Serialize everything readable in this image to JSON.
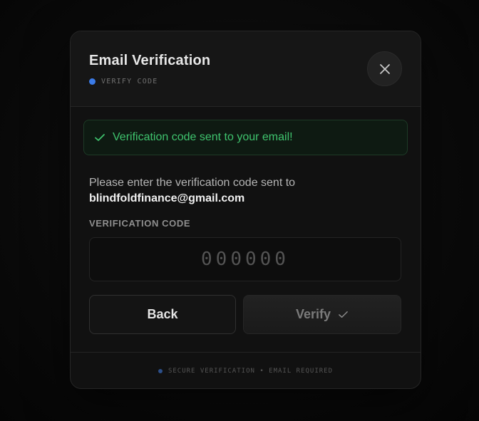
{
  "modal": {
    "title": "Email Verification",
    "subtitle": "VERIFY CODE",
    "close_icon": "close-icon"
  },
  "alert": {
    "icon": "check-icon",
    "message": "Verification code sent to your email!"
  },
  "instruction": {
    "text": "Please enter the verification code sent to",
    "email": "blindfoldfinance@gmail.com"
  },
  "code_field": {
    "label": "VERIFICATION CODE",
    "placeholder": "000000",
    "value": ""
  },
  "buttons": {
    "back_label": "Back",
    "verify_label": "Verify",
    "verify_icon": "check-icon"
  },
  "footer": {
    "text": "SECURE VERIFICATION • EMAIL REQUIRED"
  },
  "colors": {
    "accent_blue": "#3b7be8",
    "success_green": "#3fc46e",
    "background": "#0b0b0b"
  }
}
